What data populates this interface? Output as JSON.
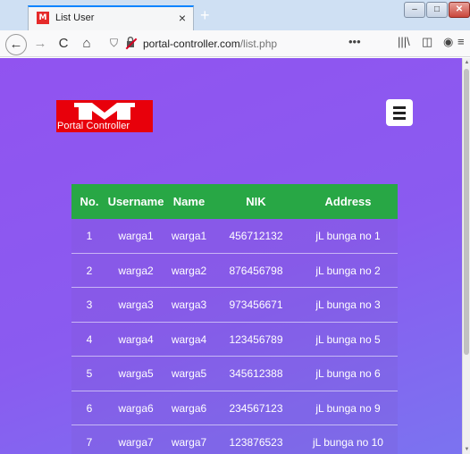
{
  "browser": {
    "tab_title": "List User",
    "favicon_text": "M",
    "tab_close": "×",
    "new_tab": "+",
    "url_domain": "portal-controller.com",
    "url_path": "/list.php",
    "page_menu": "•••",
    "window_buttons": {
      "minimize": "–",
      "maximize": "□",
      "close": "✕"
    },
    "icons": {
      "back": "←",
      "forward": "→",
      "reload": "C",
      "home": "⌂",
      "shield": "⛉",
      "library": "|||\\",
      "sidebar": "◫",
      "account": "◉",
      "menu": "≡"
    },
    "accent_color": "#0a84ff"
  },
  "page": {
    "logo_text": "Portal Controller",
    "logo_color": "#e8000b",
    "header_color": "#28a745",
    "table": {
      "headers": [
        "No.",
        "Username",
        "Name",
        "NIK",
        "Address"
      ],
      "rows": [
        [
          "1",
          "warga1",
          "warga1",
          "456712132",
          "jL bunga no 1"
        ],
        [
          "2",
          "warga2",
          "warga2",
          "876456798",
          "jL bunga no 2"
        ],
        [
          "3",
          "warga3",
          "warga3",
          "973456671",
          "jL bunga no 3"
        ],
        [
          "4",
          "warga4",
          "warga4",
          "123456789",
          "jL bunga no 5"
        ],
        [
          "5",
          "warga5",
          "warga5",
          "345612388",
          "jL bunga no 6"
        ],
        [
          "6",
          "warga6",
          "warga6",
          "234567123",
          "jL bunga no 9"
        ],
        [
          "7",
          "warga7",
          "warga7",
          "123876523",
          "jL bunga no 10"
        ]
      ]
    }
  }
}
